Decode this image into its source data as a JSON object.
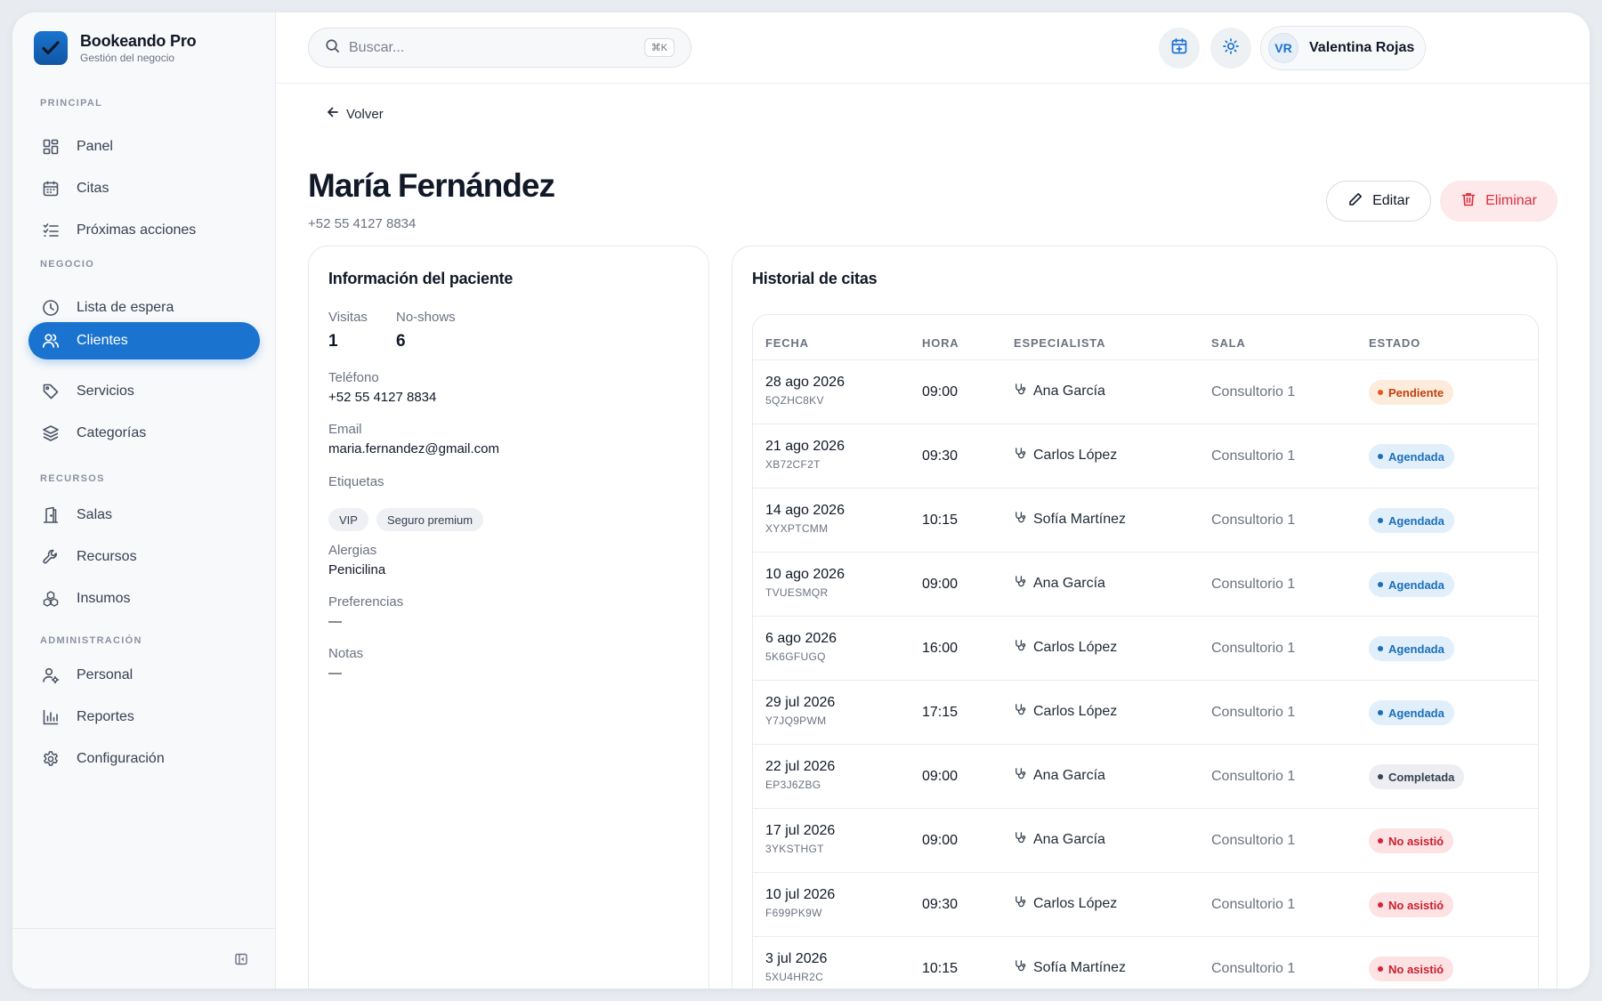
{
  "brand": {
    "name": "Bookeando Pro",
    "subtitle": "Gestión del negocio"
  },
  "sidebar": {
    "sections": [
      {
        "title": "PRINCIPAL",
        "items": [
          {
            "label": "Panel",
            "icon": "grid-icon"
          },
          {
            "label": "Citas",
            "icon": "calendar-icon"
          },
          {
            "label": "Próximas acciones",
            "icon": "checklist-icon"
          }
        ]
      },
      {
        "title": "NEGOCIO",
        "items": [
          {
            "label": "Lista de espera",
            "icon": "clock-icon"
          },
          {
            "label": "Clientes",
            "icon": "users-icon",
            "active": true
          },
          {
            "label": "Servicios",
            "icon": "tag-icon"
          },
          {
            "label": "Categorías",
            "icon": "layers-icon"
          }
        ]
      },
      {
        "title": "RECURSOS",
        "items": [
          {
            "label": "Salas",
            "icon": "door-icon"
          },
          {
            "label": "Recursos",
            "icon": "wrench-icon"
          },
          {
            "label": "Insumos",
            "icon": "boxes-icon"
          }
        ]
      },
      {
        "title": "ADMINISTRACIÓN",
        "items": [
          {
            "label": "Personal",
            "icon": "user-gear-icon"
          },
          {
            "label": "Reportes",
            "icon": "bar-chart-icon"
          },
          {
            "label": "Configuración",
            "icon": "gear-icon"
          }
        ]
      }
    ]
  },
  "search": {
    "placeholder": "Buscar...",
    "shortcut": "⌘K"
  },
  "user": {
    "initials": "VR",
    "name": "Valentina Rojas"
  },
  "page": {
    "back_label": "Volver",
    "title": "María Fernández",
    "phone": "+52 55 4127 8834",
    "edit_label": "Editar",
    "delete_label": "Eliminar"
  },
  "patient_info": {
    "title": "Información del paciente",
    "visits_label": "Visitas",
    "visits_value": "1",
    "noshows_label": "No-shows",
    "noshows_value": "6",
    "phone_label": "Teléfono",
    "phone_value": "+52 55 4127 8834",
    "email_label": "Email",
    "email_value": "maria.fernandez@gmail.com",
    "tags_label": "Etiquetas",
    "tags": [
      "VIP",
      "Seguro premium"
    ],
    "allergies_label": "Alergias",
    "allergies_value": "Penicilina",
    "preferences_label": "Preferencias",
    "preferences_value": "—",
    "notes_label": "Notas",
    "notes_value": "—"
  },
  "history": {
    "title": "Historial de citas",
    "columns": [
      "FECHA",
      "HORA",
      "ESPECIALISTA",
      "SALA",
      "ESTADO"
    ],
    "rows": [
      {
        "date": "28 ago 2026",
        "code": "5QZHC8KV",
        "time": "09:00",
        "specialist": "Ana García",
        "room": "Consultorio 1",
        "status": "Pendiente",
        "status_type": "pend"
      },
      {
        "date": "21 ago 2026",
        "code": "XB72CF2T",
        "time": "09:30",
        "specialist": "Carlos López",
        "room": "Consultorio 1",
        "status": "Agendada",
        "status_type": "ag"
      },
      {
        "date": "14 ago 2026",
        "code": "XYXPTCMM",
        "time": "10:15",
        "specialist": "Sofía Martínez",
        "room": "Consultorio 1",
        "status": "Agendada",
        "status_type": "ag"
      },
      {
        "date": "10 ago 2026",
        "code": "TVUESMQR",
        "time": "09:00",
        "specialist": "Ana García",
        "room": "Consultorio 1",
        "status": "Agendada",
        "status_type": "ag"
      },
      {
        "date": "6 ago 2026",
        "code": "5K6GFUGQ",
        "time": "16:00",
        "specialist": "Carlos López",
        "room": "Consultorio 1",
        "status": "Agendada",
        "status_type": "ag"
      },
      {
        "date": "29 jul 2026",
        "code": "Y7JQ9PWM",
        "time": "17:15",
        "specialist": "Carlos López",
        "room": "Consultorio 1",
        "status": "Agendada",
        "status_type": "ag"
      },
      {
        "date": "22 jul 2026",
        "code": "EP3J6ZBG",
        "time": "09:00",
        "specialist": "Ana García",
        "room": "Consultorio 1",
        "status": "Completada",
        "status_type": "comp"
      },
      {
        "date": "17 jul 2026",
        "code": "3YKSTHGT",
        "time": "09:00",
        "specialist": "Ana García",
        "room": "Consultorio 1",
        "status": "No asistió",
        "status_type": "no"
      },
      {
        "date": "10 jul 2026",
        "code": "F699PK9W",
        "time": "09:30",
        "specialist": "Carlos López",
        "room": "Consultorio 1",
        "status": "No asistió",
        "status_type": "no"
      },
      {
        "date": "3 jul 2026",
        "code": "5XU4HR2C",
        "time": "10:15",
        "specialist": "Sofía Martínez",
        "room": "Consultorio 1",
        "status": "No asistió",
        "status_type": "no"
      }
    ]
  },
  "colors": {
    "accent": "#1a73cf",
    "danger": "#dc2f3e"
  }
}
